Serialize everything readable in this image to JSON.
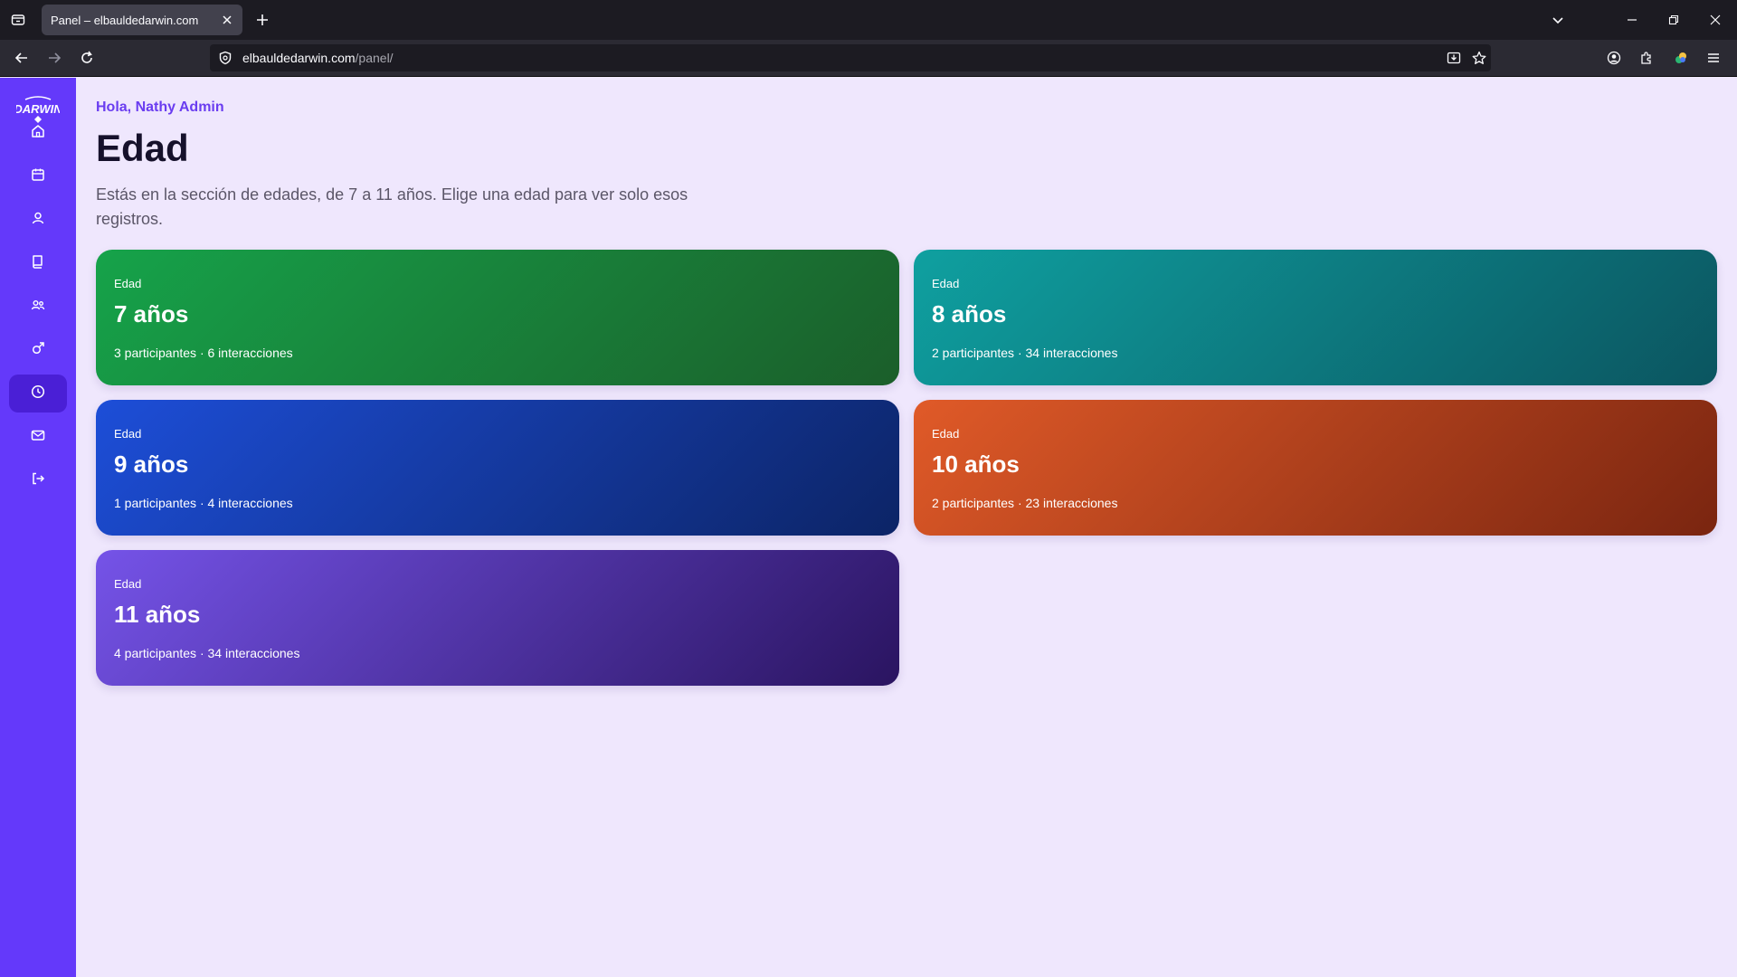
{
  "browser": {
    "tab_title": "Panel – elbauldedarwin.com",
    "url_host": "elbauldedarwin.com",
    "url_path": "/panel/"
  },
  "sidebar": {
    "logo_alt": "El Baúl de Darwin",
    "items": [
      {
        "icon": "home-icon",
        "active": false
      },
      {
        "icon": "calendar-icon",
        "active": false
      },
      {
        "icon": "user-icon",
        "active": false
      },
      {
        "icon": "book-icon",
        "active": false
      },
      {
        "icon": "users-icon",
        "active": false
      },
      {
        "icon": "gender-icon",
        "active": false
      },
      {
        "icon": "clock-icon",
        "active": true
      },
      {
        "icon": "mail-icon",
        "active": false
      },
      {
        "icon": "logout-icon",
        "active": false
      }
    ]
  },
  "header": {
    "greeting": "Hola, Nathy Admin",
    "title": "Edad",
    "description": "Estás en la sección de edades, de 7 a 11 años. Elige una edad para ver solo esos registros."
  },
  "cards": [
    {
      "label": "Edad",
      "value": "7 años",
      "meta": "3 participantes · 6 interacciones",
      "color_from": "#16a34a",
      "color_to": "#1b5e2a"
    },
    {
      "label": "Edad",
      "value": "8 años",
      "meta": "2 participantes · 34 interacciones",
      "color_from": "#0fa0a0",
      "color_to": "#0b5560"
    },
    {
      "label": "Edad",
      "value": "9 años",
      "meta": "1 participantes · 4 interacciones",
      "color_from": "#1d4ed8",
      "color_to": "#0c2466"
    },
    {
      "label": "Edad",
      "value": "10 años",
      "meta": "2 participantes · 23 interacciones",
      "color_from": "#e05a28",
      "color_to": "#7a2510"
    },
    {
      "label": "Edad",
      "value": "11 años",
      "meta": "4 participantes · 34 interacciones",
      "color_from": "#7553e8",
      "color_to": "#2a1460"
    }
  ],
  "colors": {
    "sidebar": "#6439fa",
    "sidebar_active": "#4a1fd6",
    "background": "#efe7fd",
    "accent": "#6a3df0"
  }
}
